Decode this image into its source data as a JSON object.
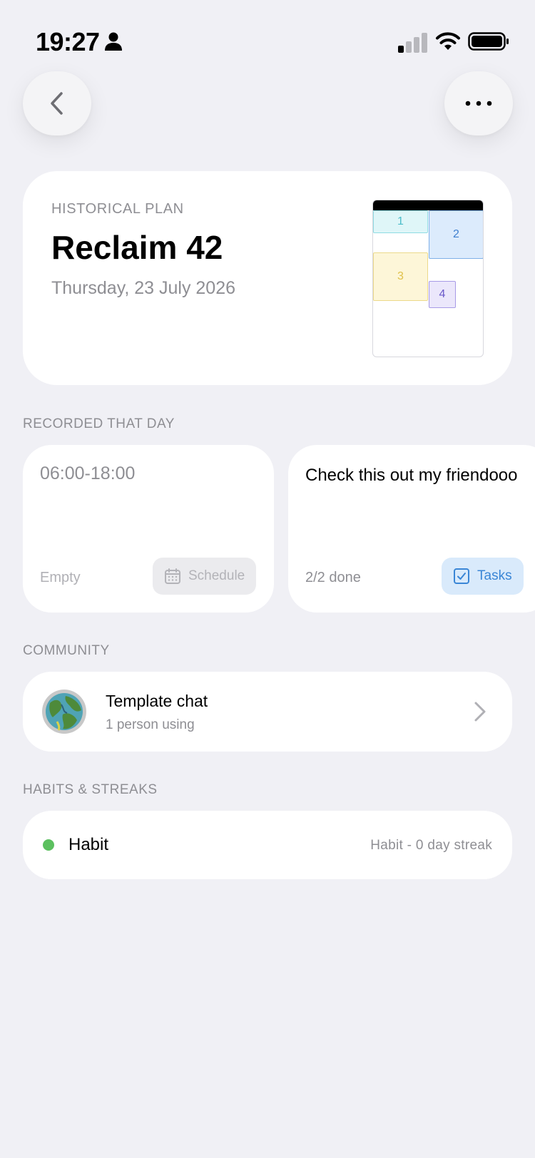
{
  "status_bar": {
    "time": "19:27",
    "icons": [
      "person-icon",
      "signal-icon",
      "wifi-icon",
      "battery-icon"
    ]
  },
  "nav": {
    "back_icon": "chevron-left-icon",
    "more_icon": "ellipsis-icon"
  },
  "plan": {
    "eyebrow": "HISTORICAL PLAN",
    "title": "Reclaim 42",
    "date": "Thursday, 23 July 2026",
    "preview_blocks": [
      "1",
      "2",
      "3",
      "4"
    ],
    "block_colors": [
      "#4bbdc9",
      "#3f7fcf",
      "#e0c14a",
      "#6a58c9"
    ]
  },
  "recorded": {
    "section_label": "RECORDED THAT DAY",
    "schedule_card": {
      "time_range": "06:00-18:00",
      "status": "Empty",
      "button_label": "Schedule"
    },
    "tasks_card": {
      "note": "Check this out my friendooo",
      "progress": "2/2 done",
      "button_label": "Tasks"
    }
  },
  "community": {
    "section_label": "COMMUNITY",
    "title": "Template chat",
    "subtitle": "1 person using"
  },
  "habits": {
    "section_label": "HABITS & STREAKS",
    "items": [
      {
        "name": "Habit",
        "streak": "Habit - 0 day streak",
        "color": "#5cc05f"
      }
    ]
  }
}
